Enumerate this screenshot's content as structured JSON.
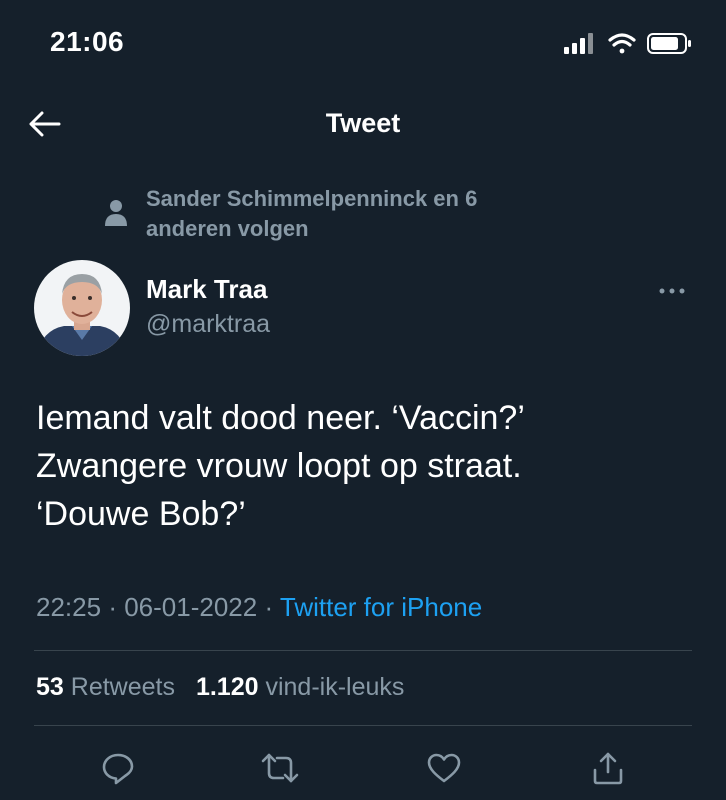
{
  "status_bar": {
    "time": "21:06"
  },
  "header": {
    "title": "Tweet"
  },
  "social_context": {
    "text": "Sander Schimmelpenninck en 6 anderen volgen"
  },
  "author": {
    "name": "Mark Traa",
    "handle": "@marktraa"
  },
  "tweet": {
    "text": "Iemand valt dood neer. ‘Vaccin?’\nZwangere vrouw loopt op straat.\n‘Douwe Bob?’",
    "time": "22:25",
    "date": "06-01-2022",
    "separator": "·",
    "source": "Twitter for iPhone"
  },
  "stats": {
    "retweets_count": "53",
    "retweets_label": "Retweets",
    "likes_count": "1.120",
    "likes_label": "vind-ik-leuks"
  },
  "colors": {
    "background": "#15202b",
    "secondary_text": "#8899a6",
    "link": "#1da1f2",
    "divider": "#38444d"
  },
  "icons": {
    "back": "arrow-left-icon",
    "social": "person-icon",
    "more": "more-horizontal-icon",
    "reply": "reply-icon",
    "retweet": "retweet-icon",
    "like": "heart-icon",
    "share": "share-icon"
  }
}
